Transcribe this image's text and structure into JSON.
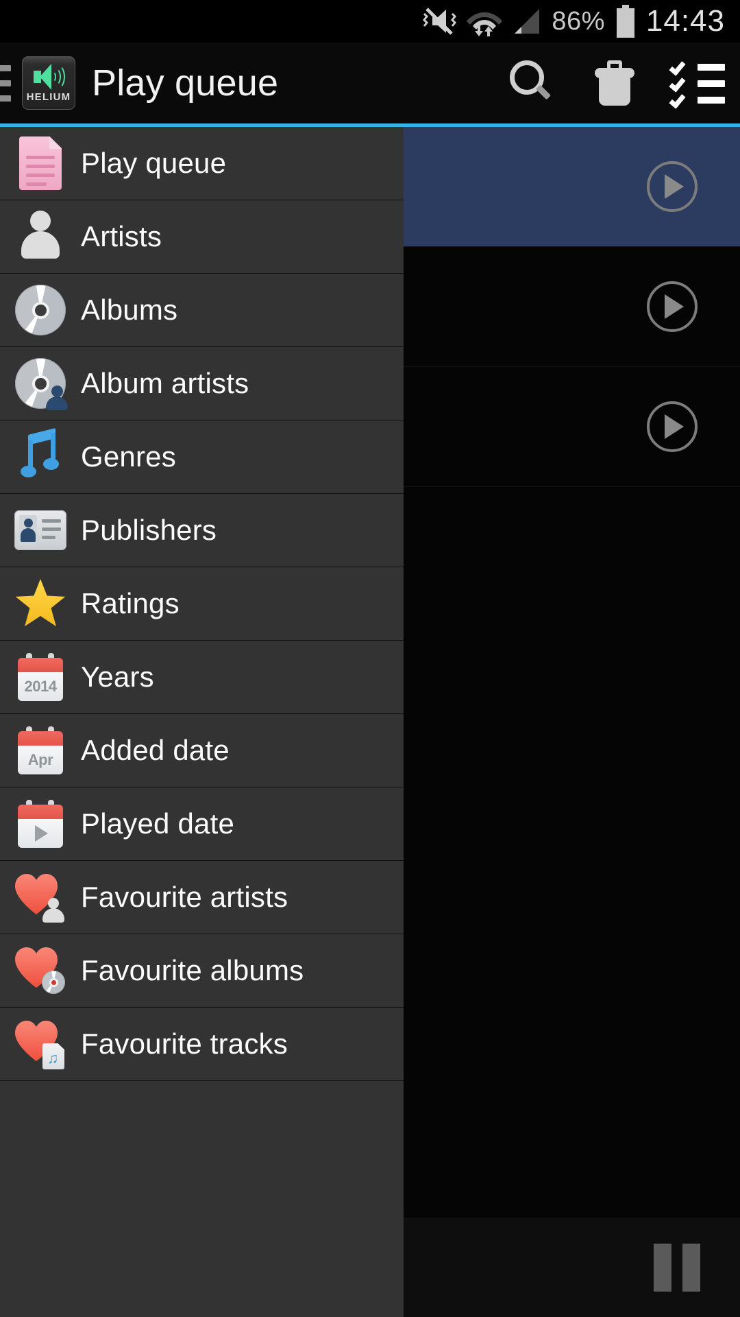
{
  "statusbar": {
    "mute_icon": "mute-vibrate-icon",
    "wifi_icon": "wifi-icon",
    "signal_icon": "cellular-signal-icon",
    "battery_percent": "86%",
    "battery_icon": "battery-icon",
    "clock": "14:43"
  },
  "actionbar": {
    "drawer_handle_icon": "hamburger-menu-icon",
    "app_icon": "helium-app-icon",
    "app_icon_label": "HELIUM",
    "title": "Play queue",
    "actions": [
      {
        "name": "search-button",
        "icon": "search-icon"
      },
      {
        "name": "delete-button",
        "icon": "trash-icon"
      },
      {
        "name": "select-mode-button",
        "icon": "checklist-icon"
      }
    ],
    "accent_color": "#33b5e5"
  },
  "drawer": {
    "background_color": "#333333",
    "items": [
      {
        "label": "Play queue",
        "icon": "playlist-document-icon"
      },
      {
        "label": "Artists",
        "icon": "person-icon"
      },
      {
        "label": "Albums",
        "icon": "cd-disc-icon"
      },
      {
        "label": "Album artists",
        "icon": "cd-disc-person-icon"
      },
      {
        "label": "Genres",
        "icon": "music-note-icon"
      },
      {
        "label": "Publishers",
        "icon": "id-card-icon"
      },
      {
        "label": "Ratings",
        "icon": "star-icon"
      },
      {
        "label": "Years",
        "icon": "calendar-icon",
        "calendar_text": "2014"
      },
      {
        "label": "Added date",
        "icon": "calendar-icon",
        "calendar_text": "Apr"
      },
      {
        "label": "Played date",
        "icon": "calendar-play-icon"
      },
      {
        "label": "Favourite artists",
        "icon": "heart-person-icon"
      },
      {
        "label": "Favourite albums",
        "icon": "heart-cd-icon"
      },
      {
        "label": "Favourite tracks",
        "icon": "heart-track-icon"
      }
    ]
  },
  "queue": {
    "rows": [
      {
        "selected": true,
        "play_icon": "play-circle-icon"
      },
      {
        "selected": false,
        "play_icon": "play-circle-icon"
      },
      {
        "selected": false,
        "play_icon": "play-circle-icon"
      }
    ],
    "selected_row_color": "#2b3c60"
  },
  "miniplayer": {
    "pause_icon": "pause-icon"
  }
}
